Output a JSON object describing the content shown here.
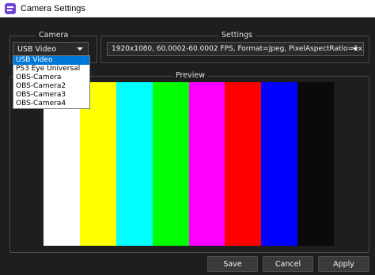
{
  "window": {
    "title": "Camera Settings"
  },
  "camera": {
    "group_label": "Camera",
    "selected": "USB Video",
    "options": [
      "USB Video",
      "PS3 Eye Universal",
      "OBS-Camera",
      "OBS-Camera2",
      "OBS-Camera3",
      "OBS-Camera4"
    ]
  },
  "settings": {
    "group_label": "Settings",
    "selected": "1920x1080, 60.0002-60.0002 FPS, Format=Jpeg, PixelAspectRatio=1x1"
  },
  "preview": {
    "group_label": "Preview",
    "bar_colors": [
      "#ffffff",
      "#ffff00",
      "#00ffff",
      "#00ff00",
      "#ff00ff",
      "#ff0000",
      "#0000ff",
      "#0a0a0a"
    ]
  },
  "buttons": {
    "save": "Save",
    "cancel": "Cancel",
    "apply": "Apply"
  }
}
